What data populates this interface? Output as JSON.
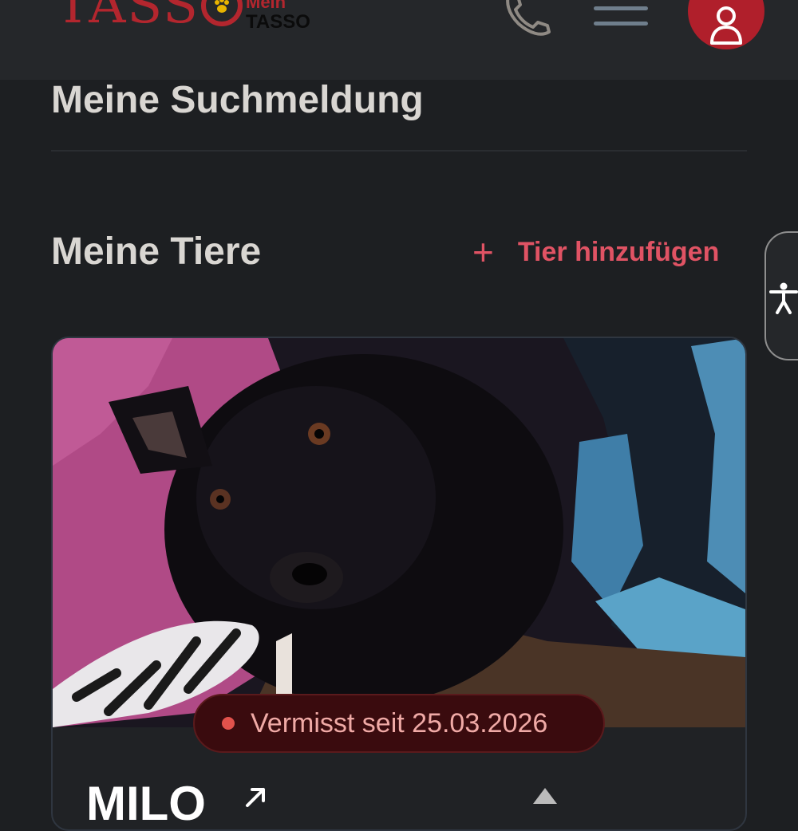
{
  "header": {
    "logo_text": "TASSO",
    "mein_label": "Mein",
    "tasso_label": "TASSO",
    "icons": [
      "paw-icon",
      "phone-icon",
      "menu-icon",
      "user-icon"
    ]
  },
  "search_section": {
    "title": "Meine Suchmeldung"
  },
  "pets_section": {
    "title": "Meine Tiere",
    "add_pet_label": "Tier hinzufügen",
    "add_icon": "+"
  },
  "accessibility": {
    "icon": "accessibility-icon"
  },
  "pet_card": {
    "status_text": "Vermisst seit 25.03.2026",
    "name": "MILO",
    "status_color": "#e1524c"
  },
  "colors": {
    "brand_red": "#b3262e",
    "accent_pink": "#e05364",
    "background": "#1d1f22"
  }
}
